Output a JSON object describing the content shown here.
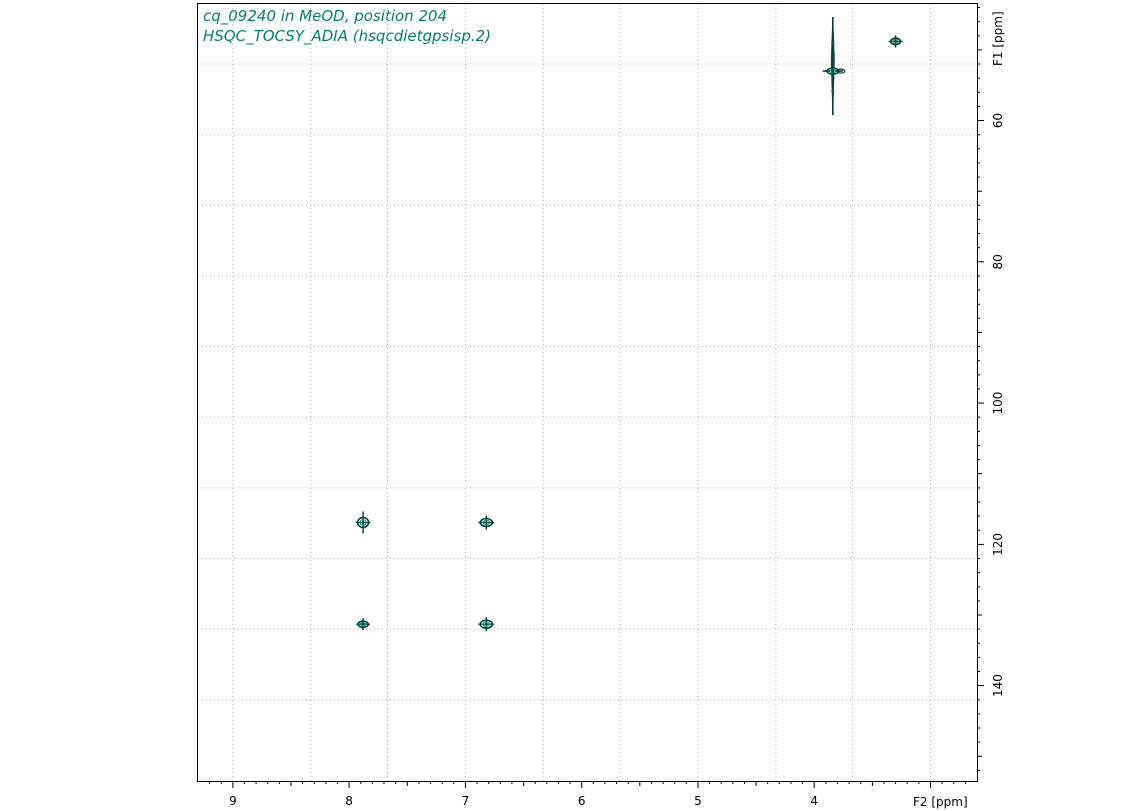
{
  "header": {
    "line1": "cq_09240 in MeOD, position 204",
    "line2": "HSQC_TOCSY_ADIA (hsqcdietgpsisp.2)"
  },
  "colors": {
    "title": "#008070",
    "contour_dark": "#00403a",
    "contour_light": "#009080",
    "grid": "#b0b0b0"
  },
  "chart_data": {
    "type": "scatter",
    "xlabel": "F2 [ppm]",
    "ylabel": "F1 [ppm]",
    "xlim": [
      9.3,
      2.6
    ],
    "ylim": [
      43.5,
      153.5
    ],
    "x_reversed": true,
    "grid": true,
    "x_ticks": [
      9,
      8,
      7,
      6,
      5,
      4
    ],
    "x_tick_labels": [
      "9",
      "8",
      "7",
      "6",
      "5",
      "4"
    ],
    "x_grid": [
      9.0,
      8.33,
      7.67,
      7.0,
      6.33,
      5.67,
      5.0,
      4.33,
      3.67,
      3.0
    ],
    "y_ticks": [
      60,
      80,
      100,
      120,
      140
    ],
    "y_tick_labels": [
      "60",
      "80",
      "100",
      "120",
      "140"
    ],
    "y_grid": [
      52,
      62,
      72,
      82,
      92,
      102,
      112,
      122,
      132,
      142
    ],
    "peaks": [
      {
        "x": 7.88,
        "y": 116.9,
        "size": "large"
      },
      {
        "x": 6.82,
        "y": 116.9,
        "size": "medium"
      },
      {
        "x": 7.88,
        "y": 131.3,
        "size": "small"
      },
      {
        "x": 6.82,
        "y": 131.3,
        "size": "medium"
      },
      {
        "x": 3.84,
        "y": 53.0,
        "size": "streak"
      },
      {
        "x": 3.3,
        "y": 48.8,
        "size": "small"
      }
    ]
  }
}
